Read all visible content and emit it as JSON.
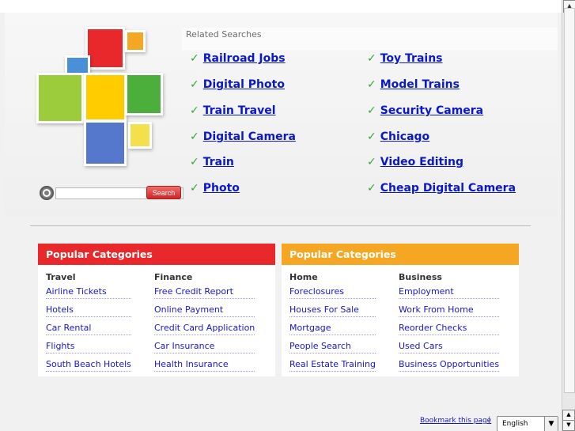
{
  "related": {
    "heading": "Related Searches",
    "left": [
      "Railroad Jobs",
      "Digital Photo",
      "Train Travel",
      "Digital Camera",
      "Train",
      "Photo"
    ],
    "right": [
      "Toy Trains",
      "Model Trains",
      "Security Camera",
      "Chicago",
      "Video Editing",
      "Cheap Digital Camera"
    ],
    "check_icon": "✓"
  },
  "search": {
    "button_label": "Search",
    "placeholder": ""
  },
  "categories": [
    {
      "header": "Popular Categories",
      "color": "#e8282b",
      "columns": [
        {
          "title": "Travel",
          "links": [
            "Airline Tickets",
            "Hotels",
            "Car Rental",
            "Flights",
            "South Beach Hotels"
          ]
        },
        {
          "title": "Finance",
          "links": [
            "Free Credit Report",
            "Online Payment",
            "Credit Card Application",
            "Car Insurance",
            "Health Insurance"
          ]
        }
      ]
    },
    {
      "header": "Popular Categories",
      "color": "#f5a623",
      "columns": [
        {
          "title": "Home",
          "links": [
            "Foreclosures",
            "Houses For Sale",
            "Mortgage",
            "People Search",
            "Real Estate Training"
          ]
        },
        {
          "title": "Business",
          "links": [
            "Employment",
            "Work From Home",
            "Reorder Checks",
            "Used Cars",
            "Business Opportunities"
          ]
        }
      ]
    }
  ],
  "footer": {
    "bookmark": "Bookmark this page",
    "separator": "|",
    "language": "English"
  },
  "icons": {
    "search": "magnifier-icon",
    "dropdown": "▼",
    "scroll_up": "▲",
    "scroll_down": "▼"
  },
  "logo_colors": [
    "#e8282b",
    "#f5a623",
    "#4a90d9",
    "#9ccc3c",
    "#ffcc00",
    "#4caf3c",
    "#5577cc",
    "#f4e04d"
  ]
}
